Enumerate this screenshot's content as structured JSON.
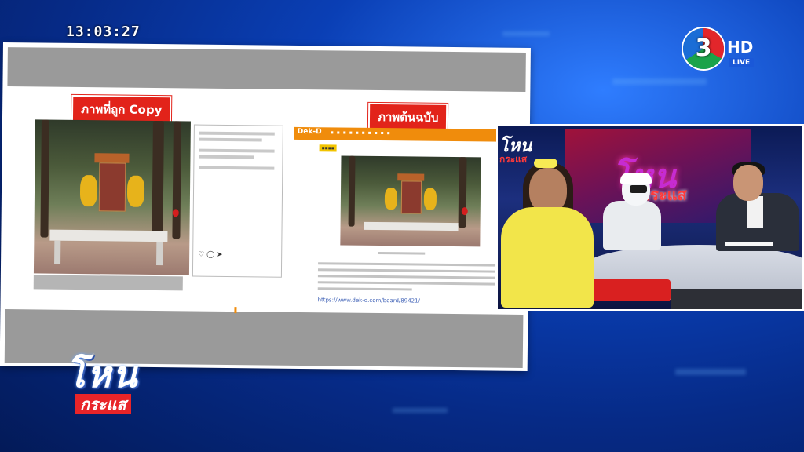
{
  "clock": "13:03:27",
  "channel": {
    "number": "3",
    "hd": "HD",
    "live": "LIVE",
    "colors": {
      "red": "#e2262b",
      "green": "#1ba34a",
      "blue": "#1b6dd6"
    }
  },
  "slide": {
    "left_label": "ภาพที่ถูก Copy",
    "right_label": "ภาพต้นฉบับ",
    "dekd": {
      "logo": "Dek-D",
      "link": "https://www.dek-d.com/board/89421/"
    }
  },
  "video": {
    "screen_title": "โหน",
    "screen_sub": "กระแส",
    "left_title": "โหน",
    "left_sub": "กระแส"
  },
  "show_logo": {
    "main": "โหน",
    "sub": "กระแส"
  },
  "colors": {
    "label_red": "#e2231a",
    "dekd_orange": "#f08c0c",
    "show_red": "#e82428"
  }
}
